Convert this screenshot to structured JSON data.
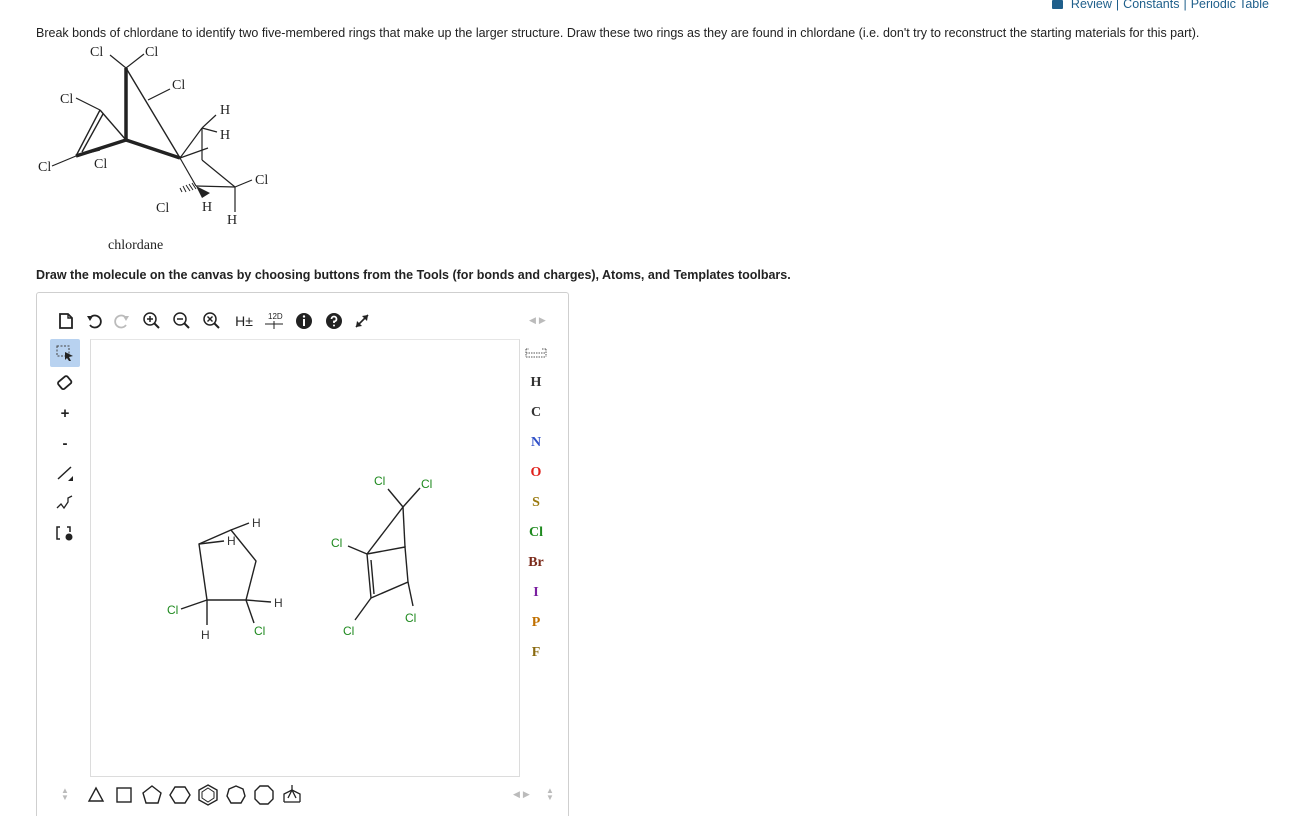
{
  "header": {
    "links": [
      "Review",
      "Constants",
      "Periodic Table"
    ],
    "separator": "|"
  },
  "question": {
    "text": "Break bonds of chlordane to identify two five-membered rings that make up the larger structure. Draw these two rings as they are found in chlordane (i.e. don't try to reconstruct the starting materials for this part)."
  },
  "structure": {
    "caption": "chlordane",
    "atom_labels": {
      "cl": "Cl",
      "h": "H"
    }
  },
  "instruction": {
    "text": "Draw the molecule on the canvas by choosing buttons from the Tools (for bonds and charges), Atoms, and Templates toolbars."
  },
  "top_toolbar": {
    "h_toggle": "H±",
    "clean_label": "12D"
  },
  "left_toolbar": {
    "plus": "+",
    "minus": "-"
  },
  "canvas": {
    "cl_label": "Cl",
    "h_label": "H"
  },
  "atoms": [
    {
      "symbol": "H",
      "color": "#333333"
    },
    {
      "symbol": "C",
      "color": "#333333"
    },
    {
      "symbol": "N",
      "color": "#3050c8"
    },
    {
      "symbol": "O",
      "color": "#e0201b"
    },
    {
      "symbol": "S",
      "color": "#9a7a10"
    },
    {
      "symbol": "Cl",
      "color": "#1f8a1f"
    },
    {
      "symbol": "Br",
      "color": "#7a2a1a"
    },
    {
      "symbol": "I",
      "color": "#7a1fa0"
    },
    {
      "symbol": "P",
      "color": "#c07000"
    },
    {
      "symbol": "F",
      "color": "#8a6a10"
    }
  ],
  "colors": {
    "link": "#1f5f8b",
    "chlorine_green": "#1f8a1f",
    "active_tool": "#b8d2f0"
  }
}
